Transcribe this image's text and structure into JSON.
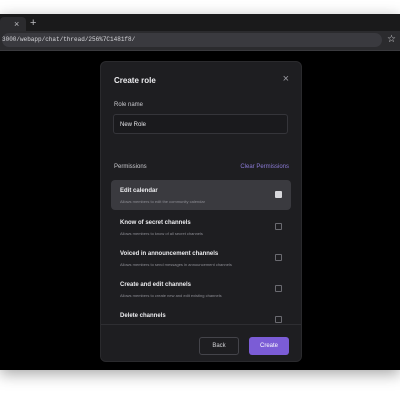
{
  "browser": {
    "tab_close": "×",
    "new_tab": "+",
    "url": "3000/webapp/chat/thread/256%7C1481f8/",
    "star_icon": "☆"
  },
  "modal": {
    "title": "Create role",
    "close_icon": "×",
    "role_name_label": "Role name",
    "role_name_value": "New Role",
    "permissions_label": "Permissions",
    "clear_permissions": "Clear Permissions",
    "permissions": [
      {
        "name": "Edit calendar",
        "description": "Allows members to edit the community calendar",
        "selected": true,
        "checked": true
      },
      {
        "name": "Know of secret channels",
        "description": "Allows members to know of all secret channels",
        "selected": false,
        "checked": false
      },
      {
        "name": "Voiced in announcement channels",
        "description": "Allows members to send messages in announcement channels",
        "selected": false,
        "checked": false
      },
      {
        "name": "Create and edit channels",
        "description": "Allows members to create new and edit existing channels",
        "selected": false,
        "checked": false
      },
      {
        "name": "Delete channels",
        "description": "",
        "selected": false,
        "checked": false
      }
    ],
    "back_label": "Back",
    "create_label": "Create"
  },
  "colors": {
    "accent": "#7b5cd6",
    "modal_bg": "#1e1e21",
    "selected_bg": "#3a3a3f"
  }
}
